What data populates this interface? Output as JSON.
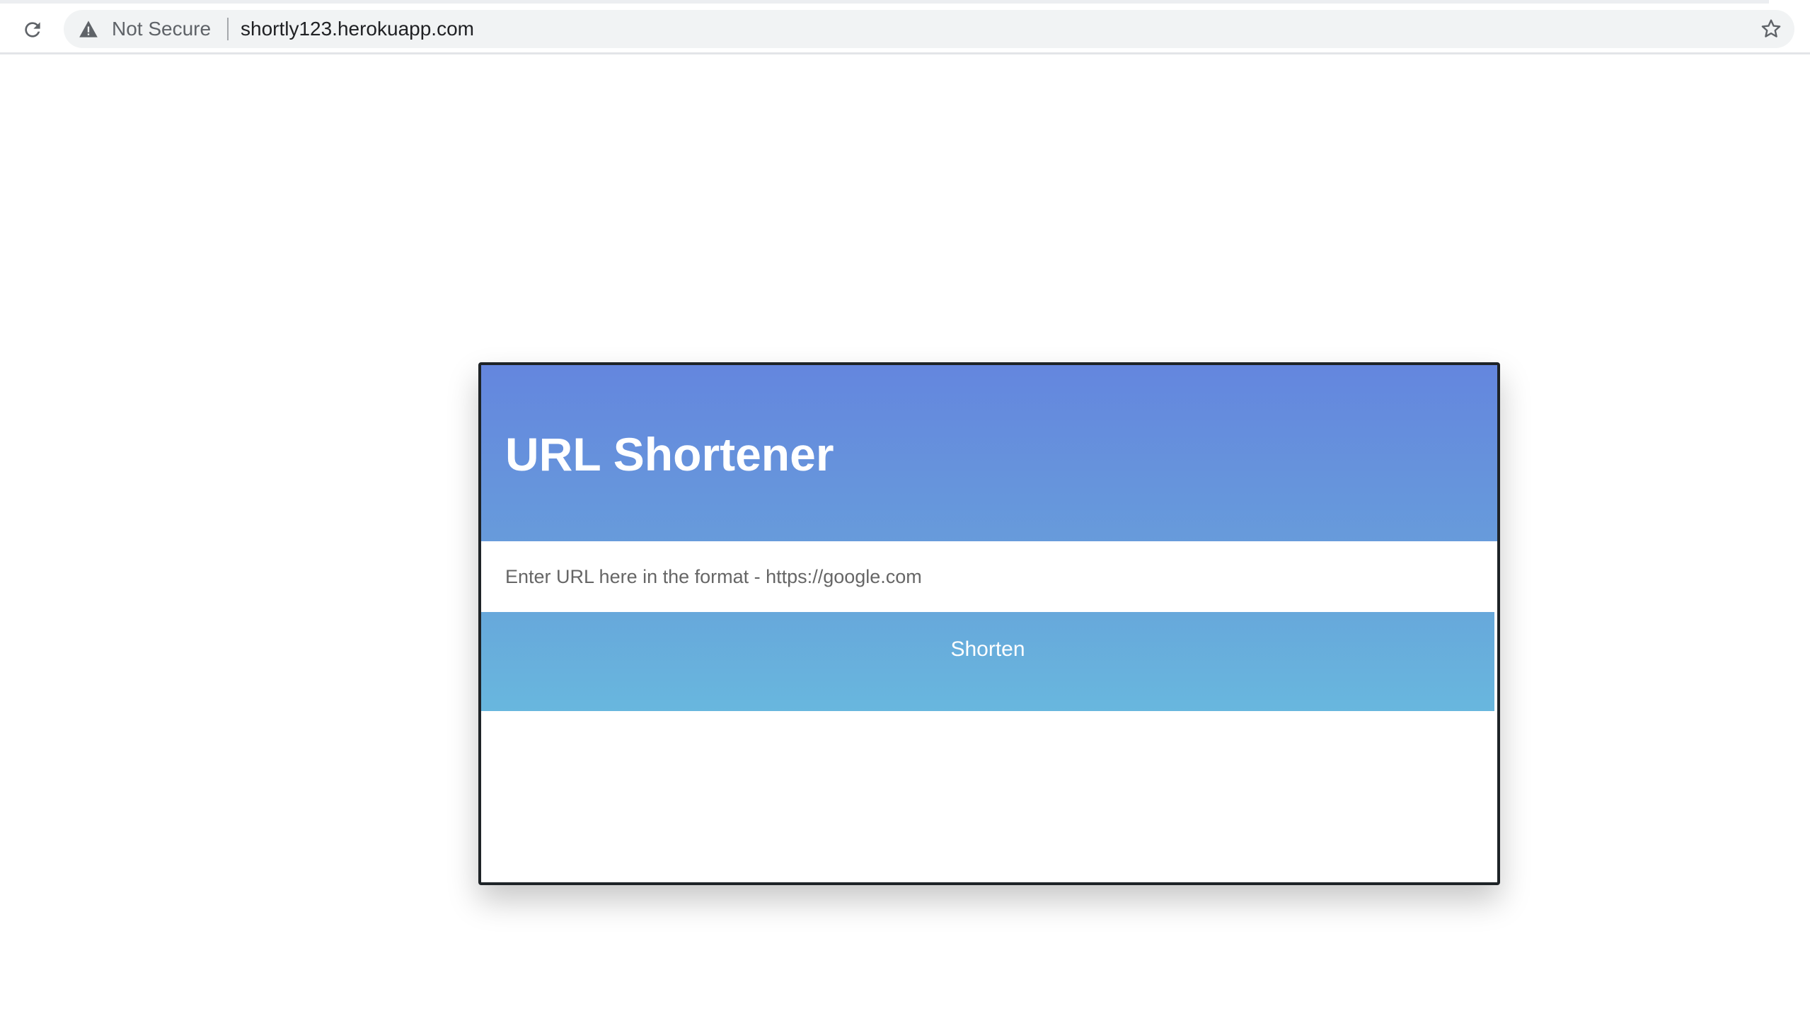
{
  "browser": {
    "security_label": "Not Secure",
    "url": "shortly123.herokuapp.com",
    "icons": {
      "reload": "reload-icon",
      "warning": "warning-triangle-icon",
      "bookmark": "star-icon"
    }
  },
  "app": {
    "title": "URL Shortener",
    "input_placeholder": "Enter URL here in the format - https://google.com",
    "input_value": "",
    "button_label": "Shorten",
    "colors": {
      "header_top": "#6486de",
      "header_bottom": "#679bdb",
      "button_top": "#67a8db",
      "button_bottom": "#68b7de",
      "border": "#1e2327"
    }
  }
}
